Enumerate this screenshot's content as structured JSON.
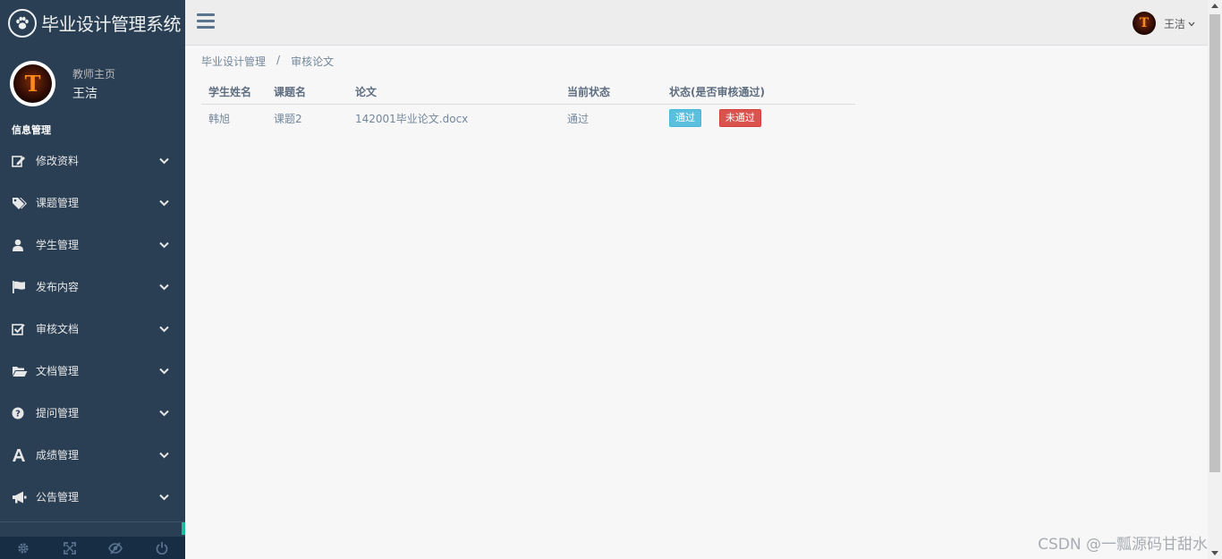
{
  "app": {
    "title": "毕业设计管理系统"
  },
  "profile": {
    "welcome": "教师主页",
    "name": "王洁",
    "avatar_letter": "T"
  },
  "sidebar": {
    "section": "信息管理",
    "items": [
      {
        "label": "修改资料",
        "icon": "edit-icon"
      },
      {
        "label": "课题管理",
        "icon": "tags-icon"
      },
      {
        "label": "学生管理",
        "icon": "user-icon"
      },
      {
        "label": "发布内容",
        "icon": "flag-icon"
      },
      {
        "label": "审核文档",
        "icon": "check-square-icon"
      },
      {
        "label": "文档管理",
        "icon": "folder-open-icon"
      },
      {
        "label": "提问管理",
        "icon": "question-circle-icon"
      },
      {
        "label": "成绩管理",
        "icon": "font-icon"
      },
      {
        "label": "公告管理",
        "icon": "bullhorn-icon"
      }
    ],
    "footer": [
      "gear-icon",
      "fullscreen-icon",
      "eye-slash-icon",
      "power-icon"
    ]
  },
  "topnav": {
    "user": "王洁"
  },
  "breadcrumb": {
    "parent": "毕业设计管理",
    "sep": "/",
    "current": "审核论文"
  },
  "table": {
    "columns": [
      "学生姓名",
      "课题名",
      "论文",
      "当前状态",
      "状态(是否审核通过)"
    ],
    "rows": [
      {
        "student": "韩旭",
        "topic": "课题2",
        "thesis": "142001毕业论文.docx",
        "status": "通过",
        "approve_label": "通过",
        "reject_label": "未通过"
      }
    ]
  },
  "watermark": "CSDN @一瓢源码甘甜水",
  "colors": {
    "sidebar": "#2a3f54",
    "accent": "#1abb9c",
    "info": "#5bc0de",
    "danger": "#d9534f"
  }
}
